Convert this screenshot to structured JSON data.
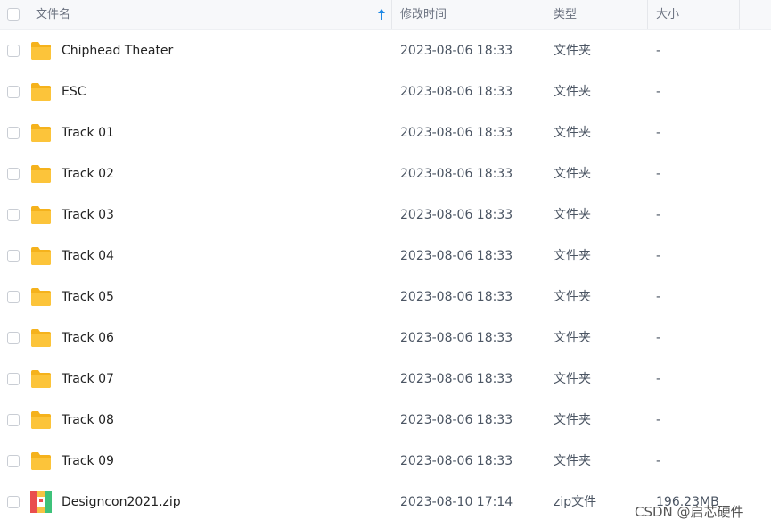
{
  "header": {
    "name_label": "文件名",
    "modified_label": "修改时间",
    "type_label": "类型",
    "size_label": "大小"
  },
  "files": [
    {
      "name": "Chiphead Theater",
      "modified": "2023-08-06 18:33",
      "type": "文件夹",
      "size": "-",
      "icon": "folder-icon"
    },
    {
      "name": "ESC",
      "modified": "2023-08-06 18:33",
      "type": "文件夹",
      "size": "-",
      "icon": "folder-icon"
    },
    {
      "name": "Track 01",
      "modified": "2023-08-06 18:33",
      "type": "文件夹",
      "size": "-",
      "icon": "folder-icon"
    },
    {
      "name": "Track 02",
      "modified": "2023-08-06 18:33",
      "type": "文件夹",
      "size": "-",
      "icon": "folder-icon"
    },
    {
      "name": "Track 03",
      "modified": "2023-08-06 18:33",
      "type": "文件夹",
      "size": "-",
      "icon": "folder-icon"
    },
    {
      "name": "Track 04",
      "modified": "2023-08-06 18:33",
      "type": "文件夹",
      "size": "-",
      "icon": "folder-icon"
    },
    {
      "name": "Track 05",
      "modified": "2023-08-06 18:33",
      "type": "文件夹",
      "size": "-",
      "icon": "folder-icon"
    },
    {
      "name": "Track 06",
      "modified": "2023-08-06 18:33",
      "type": "文件夹",
      "size": "-",
      "icon": "folder-icon"
    },
    {
      "name": "Track 07",
      "modified": "2023-08-06 18:33",
      "type": "文件夹",
      "size": "-",
      "icon": "folder-icon"
    },
    {
      "name": "Track 08",
      "modified": "2023-08-06 18:33",
      "type": "文件夹",
      "size": "-",
      "icon": "folder-icon"
    },
    {
      "name": "Track 09",
      "modified": "2023-08-06 18:33",
      "type": "文件夹",
      "size": "-",
      "icon": "folder-icon"
    },
    {
      "name": "Designcon2021.zip",
      "modified": "2023-08-10 17:14",
      "type": "zip文件",
      "size": "196.23MB",
      "icon": "zip-file-icon"
    }
  ],
  "watermark": "CSDN @启芯硬件",
  "colors": {
    "folder": "#fcc43a",
    "folder_tab": "#f5b21c",
    "sort_arrow": "#1e88e5"
  }
}
